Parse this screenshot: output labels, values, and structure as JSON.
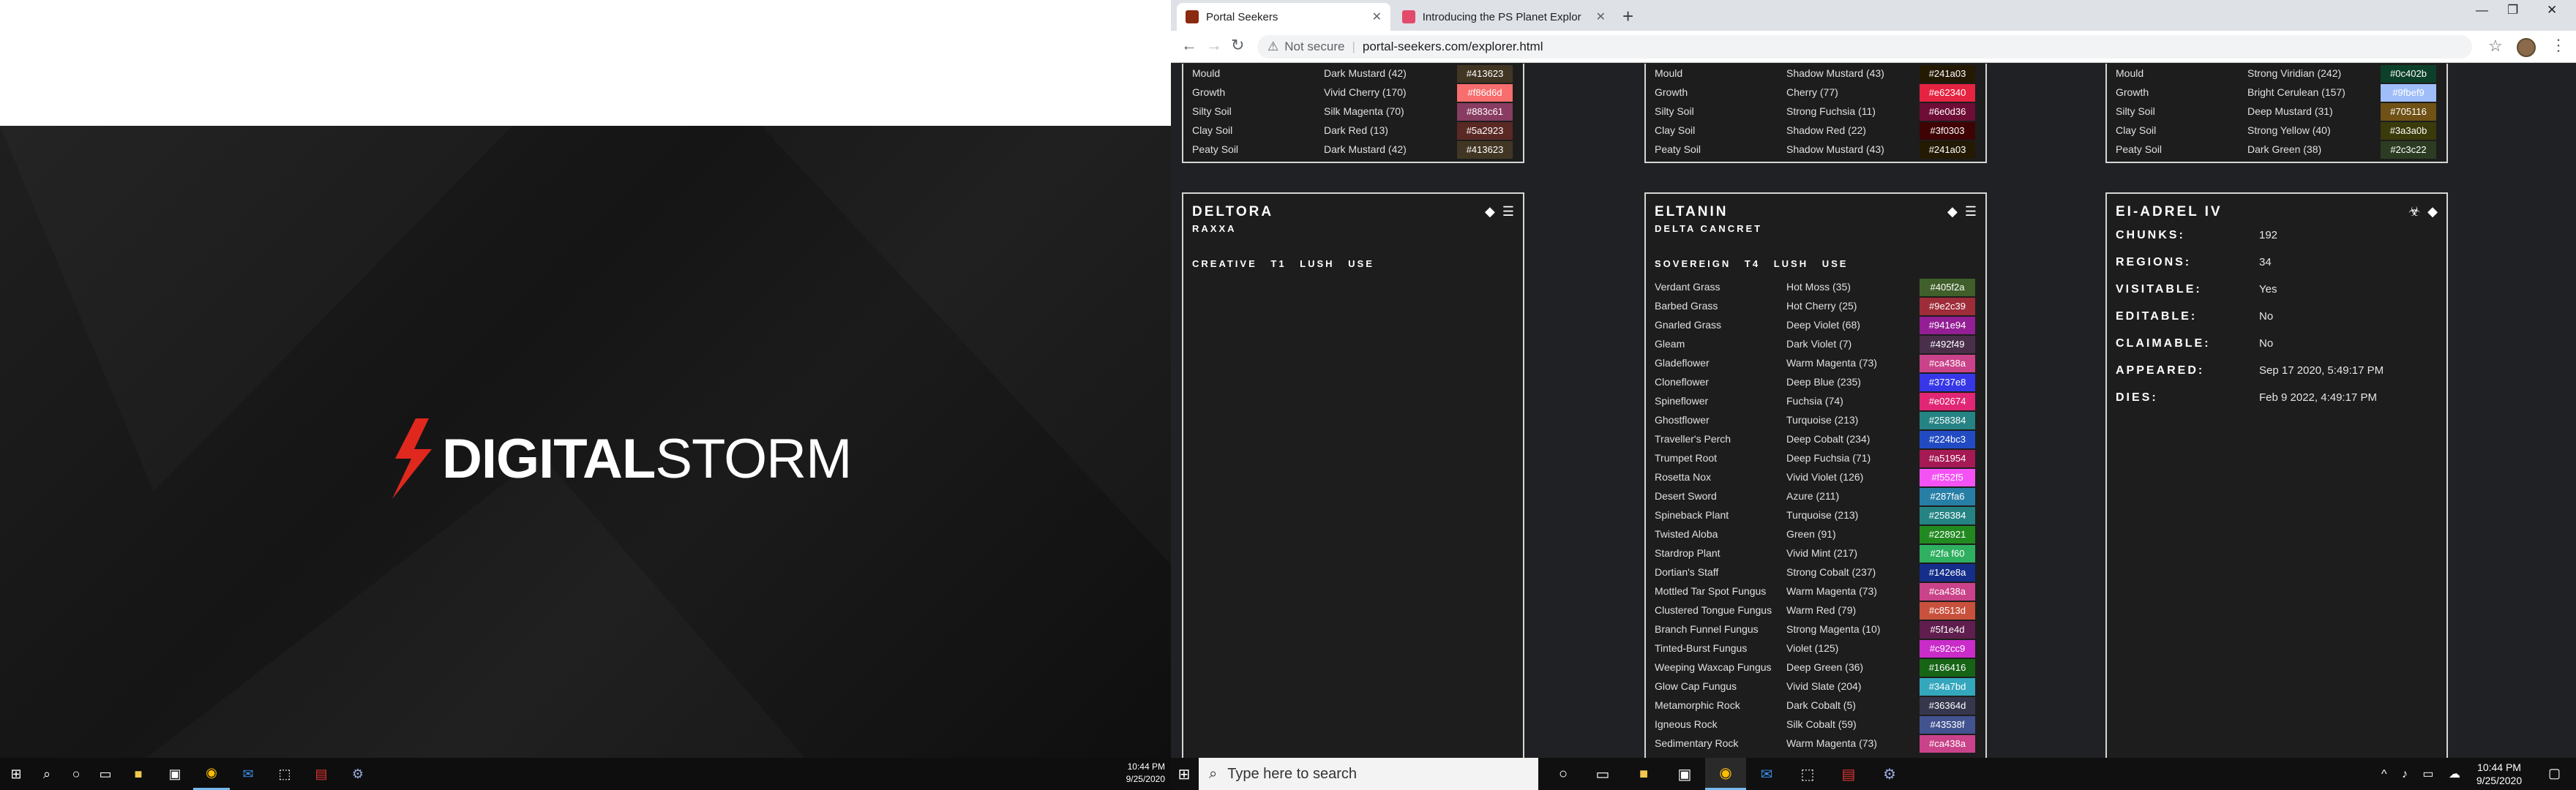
{
  "left_monitor": {
    "logo_bold": "DIGITAL",
    "logo_light": "STORM",
    "clock": {
      "time": "10:44 PM",
      "date": "9/25/2020"
    }
  },
  "browser": {
    "tabs": [
      {
        "label": "Portal Seekers",
        "active": true
      },
      {
        "label": "Introducing the PS Planet Explor",
        "active": false
      }
    ],
    "security": "Not secure",
    "url": "portal-seekers.com/explorer.html"
  },
  "top_cards": [
    {
      "rows": [
        {
          "name": "Mould",
          "color_name": "Dark Mustard (42)",
          "hex": "#413623"
        },
        {
          "name": "Growth",
          "color_name": "Vivid Cherry (170)",
          "hex": "#f86d6d"
        },
        {
          "name": "Silty Soil",
          "color_name": "Silk Magenta (70)",
          "hex": "#883c61"
        },
        {
          "name": "Clay Soil",
          "color_name": "Dark Red (13)",
          "hex": "#5a2923"
        },
        {
          "name": "Peaty Soil",
          "color_name": "Dark Mustard (42)",
          "hex": "#413623"
        }
      ]
    },
    {
      "rows": [
        {
          "name": "Mould",
          "color_name": "Shadow Mustard (43)",
          "hex": "#241a03"
        },
        {
          "name": "Growth",
          "color_name": "Cherry (77)",
          "hex": "#e62340"
        },
        {
          "name": "Silty Soil",
          "color_name": "Strong Fuchsia (11)",
          "hex": "#6e0d36"
        },
        {
          "name": "Clay Soil",
          "color_name": "Shadow Red (22)",
          "hex": "#3f0303"
        },
        {
          "name": "Peaty Soil",
          "color_name": "Shadow Mustard (43)",
          "hex": "#241a03"
        }
      ]
    },
    {
      "rows": [
        {
          "name": "Mould",
          "color_name": "Strong Viridian (242)",
          "hex": "#0c402b"
        },
        {
          "name": "Growth",
          "color_name": "Bright Cerulean (157)",
          "hex": "#9fbef9"
        },
        {
          "name": "Silty Soil",
          "color_name": "Deep Mustard (31)",
          "hex": "#705116"
        },
        {
          "name": "Clay Soil",
          "color_name": "Strong Yellow (40)",
          "hex": "#3a3a0b"
        },
        {
          "name": "Peaty Soil",
          "color_name": "Dark Green (38)",
          "hex": "#2c3c22"
        }
      ]
    }
  ],
  "deltora": {
    "title": "DELTORA",
    "sub": "RAXXA",
    "tags": "CREATIVE T1 LUSH USE"
  },
  "eltanin": {
    "title": "ELTANIN",
    "sub": "DELTA CANCRET",
    "tags": "SOVEREIGN T4 LUSH USE",
    "rows": [
      {
        "name": "Verdant Grass",
        "color_name": "Hot Moss (35)",
        "hex": "#405f2a"
      },
      {
        "name": "Barbed Grass",
        "color_name": "Hot Cherry (25)",
        "hex": "#9e2c39"
      },
      {
        "name": "Gnarled Grass",
        "color_name": "Deep Violet (68)",
        "hex": "#941e94"
      },
      {
        "name": "Gleam",
        "color_name": "Dark Violet (7)",
        "hex": "#492f49"
      },
      {
        "name": "Gladeflower",
        "color_name": "Warm Magenta (73)",
        "hex": "#ca438a"
      },
      {
        "name": "Cloneflower",
        "color_name": "Deep Blue (235)",
        "hex": "#3737e8"
      },
      {
        "name": "Spineflower",
        "color_name": "Fuchsia (74)",
        "hex": "#e02674"
      },
      {
        "name": "Ghostflower",
        "color_name": "Turquoise (213)",
        "hex": "#258384"
      },
      {
        "name": "Traveller's Perch",
        "color_name": "Deep Cobalt (234)",
        "hex": "#224bc3"
      },
      {
        "name": "Trumpet Root",
        "color_name": "Deep Fuchsia (71)",
        "hex": "#a51954"
      },
      {
        "name": "Rosetta Nox",
        "color_name": "Vivid Violet (126)",
        "hex": "#f552f5"
      },
      {
        "name": "Desert Sword",
        "color_name": "Azure (211)",
        "hex": "#287fa6"
      },
      {
        "name": "Spineback Plant",
        "color_name": "Turquoise (213)",
        "hex": "#258384"
      },
      {
        "name": "Twisted Aloba",
        "color_name": "Green (91)",
        "hex": "#228921"
      },
      {
        "name": "Stardrop Plant",
        "color_name": "Vivid Mint (217)",
        "hex": "#2fa f60"
      },
      {
        "name": "Dortian's Staff",
        "color_name": "Strong Cobalt (237)",
        "hex": "#142e8a"
      },
      {
        "name": "Mottled Tar Spot Fungus",
        "color_name": "Warm Magenta (73)",
        "hex": "#ca438a"
      },
      {
        "name": "Clustered Tongue Fungus",
        "color_name": "Warm Red (79)",
        "hex": "#c8513d"
      },
      {
        "name": "Branch Funnel Fungus",
        "color_name": "Strong Magenta (10)",
        "hex": "#5f1e4d"
      },
      {
        "name": "Tinted-Burst Fungus",
        "color_name": "Violet (125)",
        "hex": "#c92cc9"
      },
      {
        "name": "Weeping Waxcap Fungus",
        "color_name": "Deep Green (36)",
        "hex": "#166416"
      },
      {
        "name": "Glow Cap Fungus",
        "color_name": "Vivid Slate (204)",
        "hex": "#34a7bd"
      },
      {
        "name": "Metamorphic Rock",
        "color_name": "Dark Cobalt (5)",
        "hex": "#36364d"
      },
      {
        "name": "Igneous Rock",
        "color_name": "Silk Cobalt (59)",
        "hex": "#43538f"
      },
      {
        "name": "Sedimentary Rock",
        "color_name": "Warm Magenta (73)",
        "hex": "#ca438a"
      }
    ]
  },
  "eiadrel": {
    "title": "EI-ADREL IV",
    "info": [
      {
        "k": "CHUNKS:",
        "v": "192"
      },
      {
        "k": "REGIONS:",
        "v": "34"
      },
      {
        "k": "VISITABLE:",
        "v": "Yes"
      },
      {
        "k": "EDITABLE:",
        "v": "No"
      },
      {
        "k": "CLAIMABLE:",
        "v": "No"
      },
      {
        "k": "APPEARED:",
        "v": "Sep 17 2020, 5:49:17 PM"
      },
      {
        "k": "DIES:",
        "v": "Feb 9 2022, 4:49:17 PM"
      }
    ]
  },
  "taskbar": {
    "search_placeholder": "Type here to search",
    "clock": {
      "time": "10:44 PM",
      "date": "9/25/2020"
    }
  }
}
